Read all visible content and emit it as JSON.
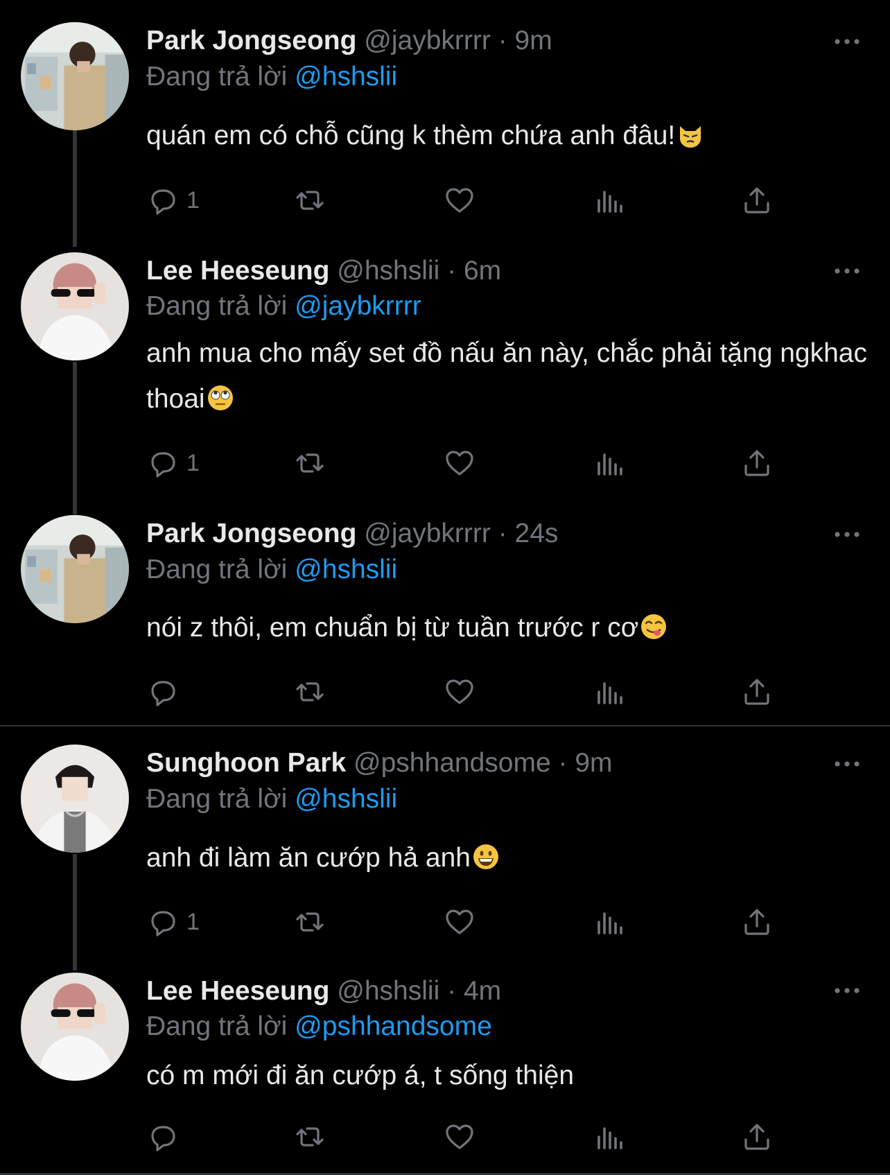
{
  "colors": {
    "background": "#000000",
    "text": "#e7e9ea",
    "muted": "#71767b",
    "link": "#1d9bf0",
    "divider": "#2f3336"
  },
  "icons": {
    "reply": "reply-icon",
    "retweet": "retweet-icon",
    "like": "heart-icon",
    "views": "views-icon",
    "share": "share-icon",
    "more": "more-icon"
  },
  "reply_prefix": "Đang trả lời",
  "tweets": [
    {
      "name": "Park Jongseong",
      "handle": "@jaybkrrrr",
      "dot": "·",
      "time": "9m",
      "replying_to": "@hshslii",
      "text": "quán em có chỗ cũng k thèm chứa anh đâu!",
      "emoji": "pouting-cat",
      "reply_count": "1"
    },
    {
      "name": "Lee Heeseung",
      "handle": "@hshslii",
      "dot": "·",
      "time": "6m",
      "replying_to": "@jaybkrrrr",
      "text": "anh mua cho mấy set đồ nấu ăn này, chắc phải tặng ngkhac thoai",
      "emoji": "face-with-rolling-eyes",
      "reply_count": "1"
    },
    {
      "name": "Park Jongseong",
      "handle": "@jaybkrrrr",
      "dot": "·",
      "time": "24s",
      "replying_to": "@hshslii",
      "text": "nói z thôi, em chuẩn bị từ tuần trước r cơ",
      "emoji": "face-savoring-food",
      "reply_count": ""
    },
    {
      "name": "Sunghoon Park",
      "handle": "@pshhandsome",
      "dot": "·",
      "time": "9m",
      "replying_to": "@hshslii",
      "text": "anh đi làm ăn cướp hả anh",
      "emoji": "grinning-face",
      "reply_count": "1"
    },
    {
      "name": "Lee Heeseung",
      "handle": "@hshslii",
      "dot": "·",
      "time": "4m",
      "replying_to": "@pshhandsome",
      "text": "có m mới đi ăn cướp á, t sống thiện",
      "emoji": "",
      "reply_count": ""
    }
  ]
}
